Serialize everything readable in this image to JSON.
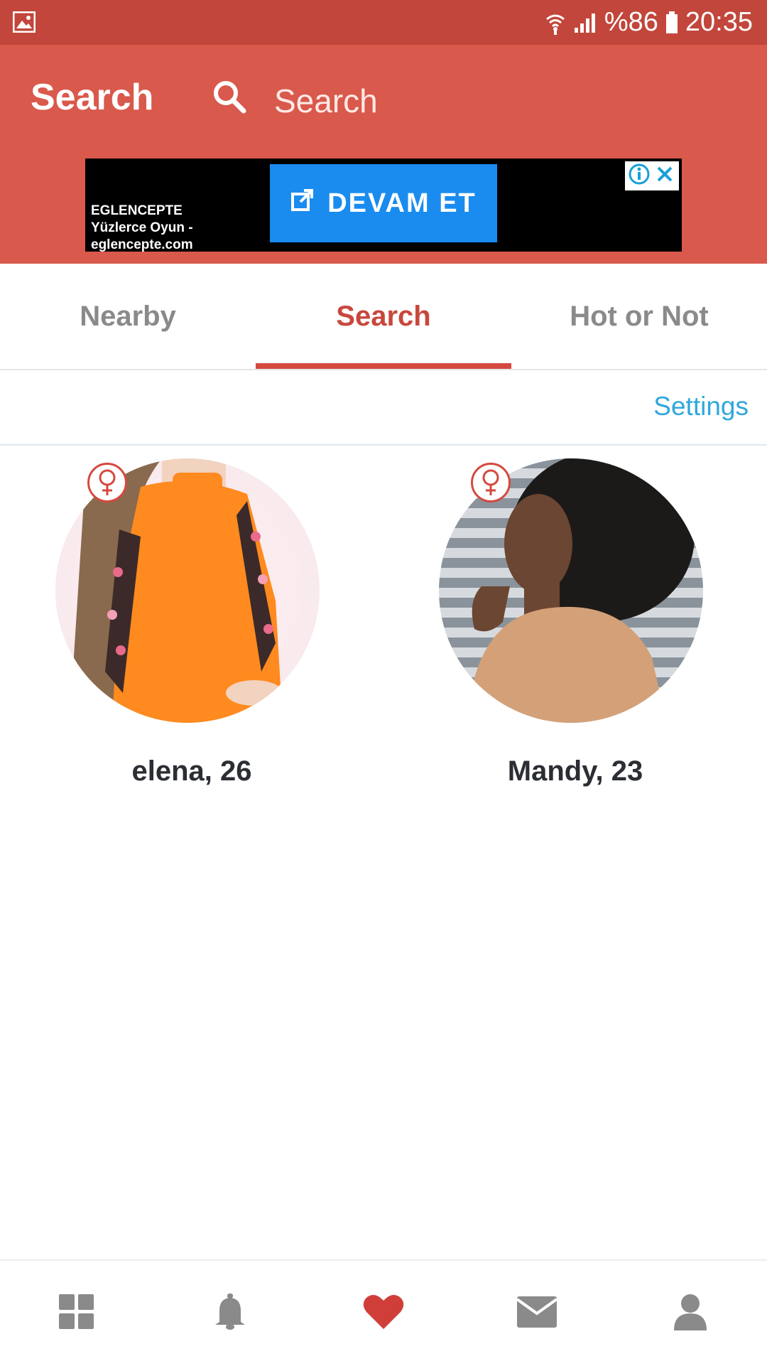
{
  "status_bar": {
    "battery": "%86",
    "time": "20:35"
  },
  "app_bar": {
    "title": "Search",
    "search_placeholder": "Search"
  },
  "ad": {
    "cta_label": "DEVAM ET",
    "brand_lines": [
      "EGLENCEPTE",
      "Yüzlerce Oyun -",
      "eglencepte.com"
    ]
  },
  "tabs": [
    {
      "label": "Nearby",
      "active": false
    },
    {
      "label": "Search",
      "active": true
    },
    {
      "label": "Hot or Not",
      "active": false
    }
  ],
  "settings_label": "Settings",
  "profiles": [
    {
      "name": "elena, 26",
      "gender": "female"
    },
    {
      "name": "Mandy, 23",
      "gender": "female"
    }
  ],
  "bottom_nav": [
    {
      "icon": "grid-icon",
      "active": false
    },
    {
      "icon": "bell-icon",
      "active": false
    },
    {
      "icon": "heart-icon",
      "active": true
    },
    {
      "icon": "mail-icon",
      "active": false
    },
    {
      "icon": "person-icon",
      "active": false
    }
  ],
  "colors": {
    "accent": "#d9594c",
    "status_bar": "#c2463b",
    "active_tab": "#c8473d",
    "link": "#2fa7dc",
    "ad_button": "#1a8cf0"
  }
}
